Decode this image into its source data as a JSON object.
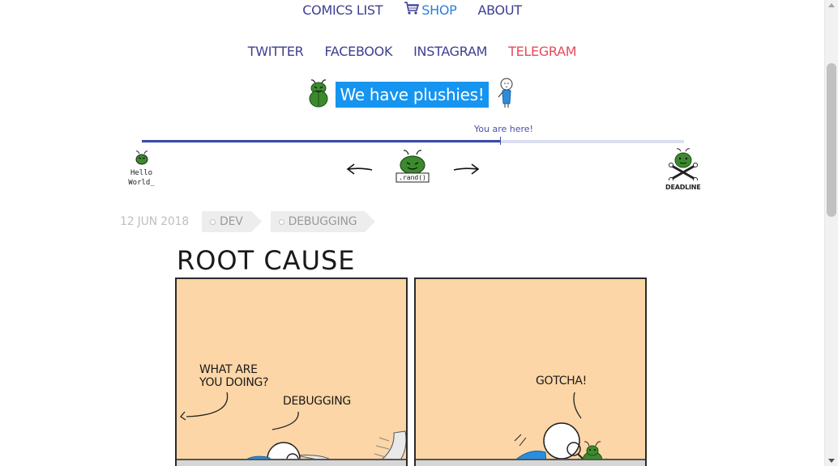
{
  "nav_top": {
    "comics_list": "COMICS LIST",
    "shop": "SHOP",
    "about": "ABOUT"
  },
  "nav_social": {
    "twitter": "TWITTER",
    "facebook": "FACEBOOK",
    "instagram": "INSTAGRAM",
    "telegram": "TELEGRAM"
  },
  "promo": {
    "label": "We have plushies!"
  },
  "progress": {
    "you_are_here": "You are here!",
    "fraction": 0.66
  },
  "strip_nav": {
    "first_label_line1": "Hello",
    "first_label_line2": "World_",
    "rand_label": ".rand()",
    "last_label": "DEADLINE"
  },
  "post": {
    "date": "12 JUN 2018",
    "tags": [
      "DEV",
      "DEBUGGING"
    ]
  },
  "comic": {
    "title": "ROOT CAUSE",
    "panel1_q_line1": "WHAT ARE",
    "panel1_q_line2": "YOU DOING?",
    "panel1_a": "DEBUGGING",
    "panel2_text": "GOTCHA!"
  },
  "colors": {
    "nav": "#3d3f91",
    "shop": "#2a7fd8",
    "telegram": "#e64b5a",
    "promo_bg": "#1594f0",
    "panel_bg": "#fcd6a6",
    "bug_green": "#3c8a2e"
  }
}
